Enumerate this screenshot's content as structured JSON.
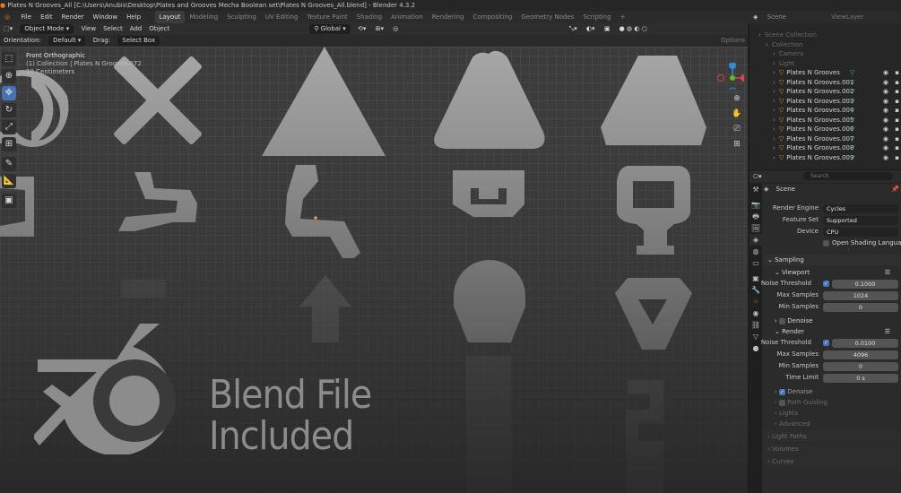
{
  "window": {
    "title": "Plates N Grooves_All [C:\\Users\\Anubis\\Desktop\\Plates and Grooves Mecha Boolean set\\Plates N Grooves_All.blend] - Blender 4.3.2"
  },
  "menu": {
    "items": [
      "File",
      "Edit",
      "Render",
      "Window",
      "Help"
    ],
    "workspaces": [
      "Layout",
      "Modeling",
      "Sculpting",
      "UV Editing",
      "Texture Paint",
      "Shading",
      "Animation",
      "Rendering",
      "Compositing",
      "Geometry Nodes",
      "Scripting"
    ],
    "active_workspace": "Layout",
    "scene_label": "Scene",
    "view_layer_label": "ViewLayer"
  },
  "viewport_header": {
    "mode": "Object Mode",
    "menus": [
      "View",
      "Select",
      "Add",
      "Object"
    ],
    "transform_orientation": "Global",
    "orientation_label": "Orientation:",
    "orientation_value": "Default",
    "drag_label": "Drag:",
    "drag_value": "Select Box",
    "options_label": "Options"
  },
  "viewport": {
    "view_name": "Front Orthographic",
    "collection_info": "(1) Collection | Plates N Grooves.072",
    "units": "10 Centimeters",
    "watermark_line1": "Blend File",
    "watermark_line2": "Included"
  },
  "toolbar": {
    "tools": [
      {
        "icon": "select-box-icon",
        "glyph": "⬚",
        "active": false
      },
      {
        "icon": "cursor-icon",
        "glyph": "⊕",
        "active": false
      },
      {
        "icon": "move-icon",
        "glyph": "✥",
        "active": true
      },
      {
        "icon": "rotate-icon",
        "glyph": "↻",
        "active": false
      },
      {
        "icon": "scale-icon",
        "glyph": "⤢",
        "active": false
      },
      {
        "icon": "transform-icon",
        "glyph": "⊞",
        "active": false
      },
      {
        "icon": "annotate-icon",
        "glyph": "✎",
        "active": false
      },
      {
        "icon": "measure-icon",
        "glyph": "📐",
        "active": false
      },
      {
        "icon": "add-cube-icon",
        "glyph": "▣",
        "active": false
      }
    ]
  },
  "outliner": {
    "header_label": "Scene Collection",
    "rows": [
      {
        "label": "Scene Collection",
        "dim": true,
        "indent": 0
      },
      {
        "label": "Collection",
        "dim": true,
        "indent": 1
      },
      {
        "label": "Camera",
        "dim": true,
        "indent": 2
      },
      {
        "label": "Light",
        "dim": true,
        "indent": 2
      },
      {
        "label": "Plates N Grooves",
        "dim": false,
        "indent": 2
      },
      {
        "label": "Plates N Grooves.001",
        "dim": false,
        "indent": 2
      },
      {
        "label": "Plates N Grooves.002",
        "dim": false,
        "indent": 2
      },
      {
        "label": "Plates N Grooves.003",
        "dim": false,
        "indent": 2
      },
      {
        "label": "Plates N Grooves.004",
        "dim": false,
        "indent": 2
      },
      {
        "label": "Plates N Grooves.005",
        "dim": false,
        "indent": 2
      },
      {
        "label": "Plates N Grooves.006",
        "dim": false,
        "indent": 2
      },
      {
        "label": "Plates N Grooves.007",
        "dim": false,
        "indent": 2
      },
      {
        "label": "Plates N Grooves.008",
        "dim": false,
        "indent": 2
      },
      {
        "label": "Plates N Grooves.009",
        "dim": false,
        "indent": 2
      }
    ]
  },
  "properties": {
    "search_placeholder": "Search",
    "context": "Scene",
    "render_engine_label": "Render Engine",
    "render_engine_value": "Cycles",
    "feature_set_label": "Feature Set",
    "feature_set_value": "Supported",
    "device_label": "Device",
    "device_value": "CPU",
    "open_shading_label": "Open Shading Language",
    "sampling_label": "Sampling",
    "viewport_label": "Viewport",
    "noise_threshold_label": "Noise Threshold",
    "viewport_noise_threshold": "0.1000",
    "max_samples_label": "Max Samples",
    "viewport_max_samples": "1024",
    "min_samples_label": "Min Samples",
    "viewport_min_samples": "0",
    "denoise_label": "Denoise",
    "render_label": "Render",
    "render_noise_threshold": "0.0100",
    "render_max_samples": "4096",
    "render_min_samples": "0",
    "time_limit_label": "Time Limit",
    "time_limit_value": "0 s",
    "path_guiding_label": "Path Guiding",
    "lights_label": "Lights",
    "advanced_label": "Advanced",
    "light_paths_label": "Light Paths",
    "volumes_label": "Volumes",
    "curves_label": "Curves"
  },
  "colors": {
    "accent": "#4772b3",
    "object_icon": "#e08a2e",
    "modifier_icon": "#3fb68f",
    "shape_fill": "#a7a7a7"
  }
}
